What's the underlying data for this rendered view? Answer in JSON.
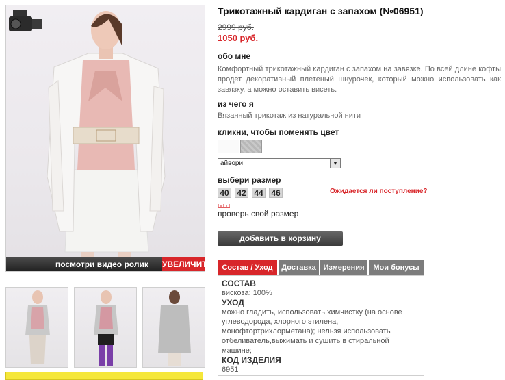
{
  "product": {
    "title": "Трикотажный кардиган с запахом (№06951)",
    "old_price": "2999 руб.",
    "new_price": "1050 руб."
  },
  "about": {
    "heading": "обо мне",
    "text": "Комфортный трикотажный кардиган с запахом на завязке. По всей длине кофты продет декоративный плетеный шнурочек, который можно использовать как завязку, а можно оставить висеть."
  },
  "material": {
    "heading": "из чего я",
    "text": "Вязанный трикотаж из натуральной нити"
  },
  "color": {
    "heading": "кликни, чтобы поменять цвет",
    "selected": "айвори",
    "swatches": [
      "white",
      "grey"
    ]
  },
  "size": {
    "heading": "выбери размер",
    "options": [
      "40",
      "42",
      "44",
      "46"
    ],
    "await_link": "Ожидается ли поступление?",
    "check_link": "проверь свой размер"
  },
  "cart": {
    "button": "добавить в корзину"
  },
  "gallery": {
    "video_label": "посмотри видео ролик",
    "enlarge_label": "УВЕЛИЧИТЬ"
  },
  "tabs": [
    {
      "label": "Состав / Уход",
      "active": true
    },
    {
      "label": "Доставка",
      "active": false
    },
    {
      "label": "Измерения",
      "active": false
    },
    {
      "label": "Мои бонусы",
      "active": false
    }
  ],
  "details": {
    "composition_head": "СОСТАВ",
    "composition": "вискоза: 100%",
    "care_head": "УХОД",
    "care": "можно гладить, использовать химчистку (на основе углеводорода, хлорного этилена, монофтортрихлорметана); нельзя использовать отбеливатель,выжимать и сушить в стиральной машине;",
    "code_head": "КОД ИЗДЕЛИЯ",
    "code": "6951"
  },
  "colors": {
    "accent": "#d8262a",
    "tab_inactive": "#7c7c7c",
    "button": "#4a4a4a"
  }
}
